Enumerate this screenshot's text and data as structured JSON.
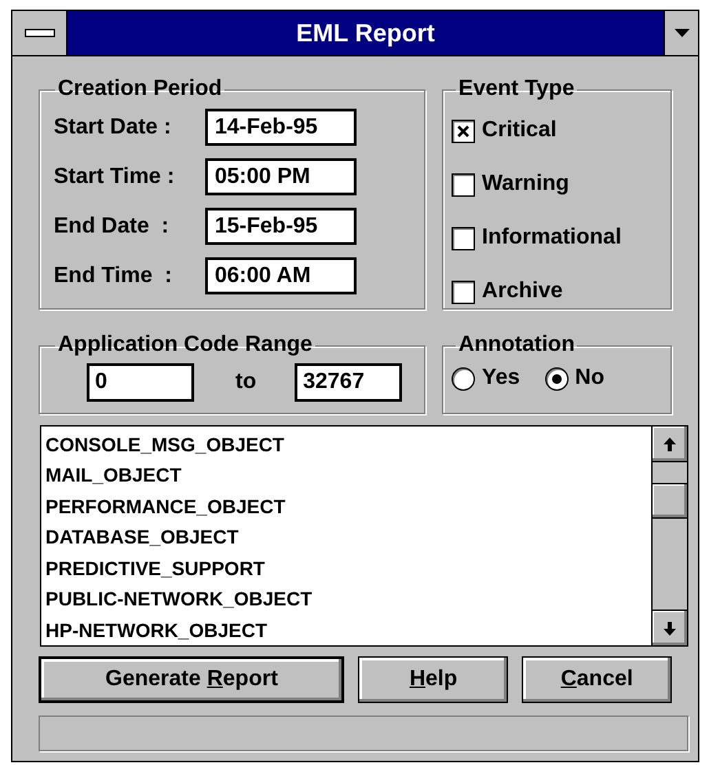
{
  "window": {
    "title": "EML Report"
  },
  "creation_period": {
    "title": "Creation Period",
    "fields": [
      {
        "label": "Start Date :",
        "value": "14-Feb-95"
      },
      {
        "label": "Start Time :",
        "value": "05:00 PM"
      },
      {
        "label": "End Date  :",
        "value": "15-Feb-95"
      },
      {
        "label": "End Time  :",
        "value": "06:00 AM"
      }
    ]
  },
  "event_type": {
    "title": "Event Type",
    "options": [
      {
        "label": "Critical",
        "checked": true
      },
      {
        "label": "Warning",
        "checked": false
      },
      {
        "label": "Informational",
        "checked": false
      },
      {
        "label": "Archive",
        "checked": false
      }
    ]
  },
  "application_code_range": {
    "title": "Application Code Range",
    "from": "0",
    "separator": "to",
    "to": "32767"
  },
  "annotation": {
    "title": "Annotation",
    "options": [
      {
        "label": "Yes",
        "selected": false
      },
      {
        "label": "No",
        "selected": true
      }
    ]
  },
  "objects": [
    "CONSOLE_MSG_OBJECT",
    "MAIL_OBJECT",
    "PERFORMANCE_OBJECT",
    "DATABASE_OBJECT",
    "PREDICTIVE_SUPPORT",
    "PUBLIC-NETWORK_OBJECT",
    "HP-NETWORK_OBJECT"
  ],
  "buttons": [
    {
      "before": "Generate ",
      "key": "R",
      "after": "eport",
      "default": true
    },
    {
      "key": "H",
      "after": "elp",
      "default": false
    },
    {
      "key": "C",
      "after": "ancel",
      "default": false
    }
  ]
}
